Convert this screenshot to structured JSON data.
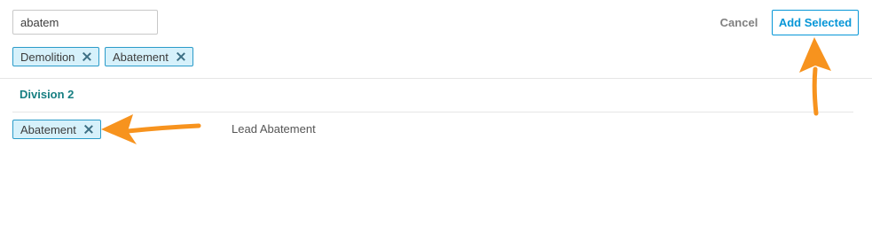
{
  "search": {
    "value": "abatem",
    "placeholder": ""
  },
  "actions": {
    "cancel_label": "Cancel",
    "add_selected_label": "Add Selected"
  },
  "selected_tags": [
    {
      "label": "Demolition"
    },
    {
      "label": "Abatement"
    }
  ],
  "division": {
    "title": "Division 2",
    "results": [
      {
        "tag_label": "Abatement",
        "name": "Lead Abatement"
      }
    ]
  },
  "colors": {
    "accent": "#0696d7",
    "chip_bg": "#d6f1fb",
    "chip_border": "#2b9bc9",
    "division_title": "#177f82",
    "annotation_arrow": "#f7931e"
  },
  "icons": {
    "chip_remove": "close-icon",
    "annotation": "arrow-icon"
  }
}
